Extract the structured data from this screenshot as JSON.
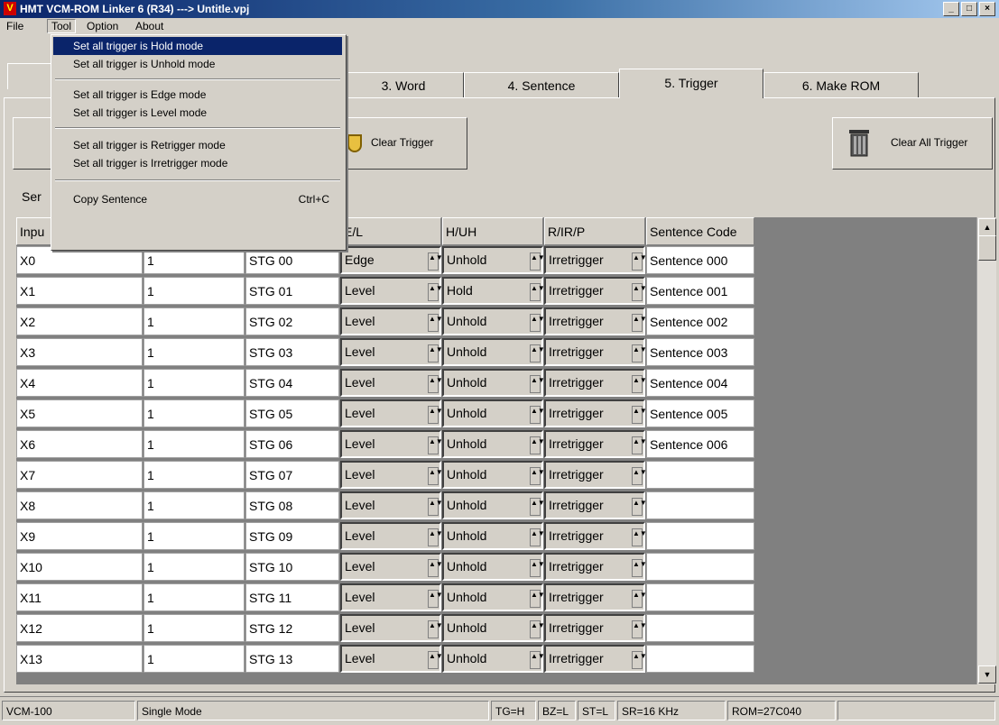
{
  "window": {
    "title": "HMT VCM-ROM Linker 6  (R34) ---> Untitle.vpj",
    "app_icon": "V",
    "controls": [
      "_",
      "□",
      "×"
    ]
  },
  "menubar": [
    "File",
    "Tool",
    "Option",
    "About"
  ],
  "tool_menu": {
    "items": [
      {
        "label": "Set all trigger is Hold mode",
        "shortcut": ""
      },
      {
        "label": "Set all trigger is Unhold mode",
        "shortcut": ""
      },
      {
        "label": "Set all trigger is Edge mode",
        "shortcut": ""
      },
      {
        "label": "Set all trigger is Level mode",
        "shortcut": ""
      },
      {
        "label": "Set all trigger is Retrigger mode",
        "shortcut": ""
      },
      {
        "label": "Set all trigger is Irretrigger mode",
        "shortcut": ""
      },
      {
        "label": "Copy Sentence",
        "shortcut": "Ctrl+C"
      }
    ]
  },
  "tabs": [
    "3. Word",
    "4. Sentence",
    "5. Trigger",
    "6. Make ROM"
  ],
  "toolbar": {
    "clear_trigger": "Clear Trigger",
    "clear_all_trigger": "Clear All Trigger"
  },
  "section_label_partial": "Ser",
  "grid": {
    "headers": [
      "Inpu",
      "",
      "",
      "E/L",
      "H/UH",
      "R/IR/P",
      "Sentence Code"
    ],
    "rows": [
      {
        "input": "X0",
        "count": "1",
        "stg": "STG 00",
        "el": "Edge",
        "huh": "Unhold",
        "rirp": "Irretrigger",
        "code": "Sentence 000"
      },
      {
        "input": "X1",
        "count": "1",
        "stg": "STG 01",
        "el": "Level",
        "huh": "Hold",
        "rirp": "Irretrigger",
        "code": "Sentence 001"
      },
      {
        "input": "X2",
        "count": "1",
        "stg": "STG 02",
        "el": "Level",
        "huh": "Unhold",
        "rirp": "Irretrigger",
        "code": "Sentence 002"
      },
      {
        "input": "X3",
        "count": "1",
        "stg": "STG 03",
        "el": "Level",
        "huh": "Unhold",
        "rirp": "Irretrigger",
        "code": "Sentence 003"
      },
      {
        "input": "X4",
        "count": "1",
        "stg": "STG 04",
        "el": "Level",
        "huh": "Unhold",
        "rirp": "Irretrigger",
        "code": "Sentence 004"
      },
      {
        "input": "X5",
        "count": "1",
        "stg": "STG 05",
        "el": "Level",
        "huh": "Unhold",
        "rirp": "Irretrigger",
        "code": "Sentence 005"
      },
      {
        "input": "X6",
        "count": "1",
        "stg": "STG 06",
        "el": "Level",
        "huh": "Unhold",
        "rirp": "Irretrigger",
        "code": "Sentence 006"
      },
      {
        "input": "X7",
        "count": "1",
        "stg": "STG 07",
        "el": "Level",
        "huh": "Unhold",
        "rirp": "Irretrigger",
        "code": ""
      },
      {
        "input": "X8",
        "count": "1",
        "stg": "STG 08",
        "el": "Level",
        "huh": "Unhold",
        "rirp": "Irretrigger",
        "code": ""
      },
      {
        "input": "X9",
        "count": "1",
        "stg": "STG 09",
        "el": "Level",
        "huh": "Unhold",
        "rirp": "Irretrigger",
        "code": ""
      },
      {
        "input": "X10",
        "count": "1",
        "stg": "STG 10",
        "el": "Level",
        "huh": "Unhold",
        "rirp": "Irretrigger",
        "code": ""
      },
      {
        "input": "X11",
        "count": "1",
        "stg": "STG 11",
        "el": "Level",
        "huh": "Unhold",
        "rirp": "Irretrigger",
        "code": ""
      },
      {
        "input": "X12",
        "count": "1",
        "stg": "STG 12",
        "el": "Level",
        "huh": "Unhold",
        "rirp": "Irretrigger",
        "code": ""
      },
      {
        "input": "X13",
        "count": "1",
        "stg": "STG 13",
        "el": "Level",
        "huh": "Unhold",
        "rirp": "Irretrigger",
        "code": ""
      }
    ]
  },
  "statusbar": [
    "VCM-100",
    "Single Mode",
    "TG=H",
    "BZ=L",
    "ST=L",
    "SR=16 KHz",
    "ROM=27C040",
    ""
  ]
}
